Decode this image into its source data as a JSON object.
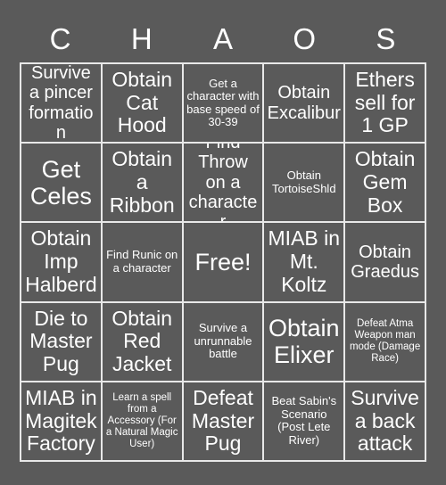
{
  "board": {
    "title_letters": [
      "C",
      "H",
      "A",
      "O",
      "S"
    ],
    "colors": {
      "background": "#5a5a5a",
      "cell_background": "#5a5a5a",
      "grid_line": "#e8e8e8",
      "text": "#ffffff"
    },
    "columns": 5,
    "rows": 5,
    "cells": [
      {
        "text": "Survive a pincer formation",
        "size": "md"
      },
      {
        "text": "Obtain Cat Hood",
        "size": "lg"
      },
      {
        "text": "Get a character with base speed of 30-39",
        "size": "sm"
      },
      {
        "text": "Obtain Excalibur",
        "size": "md"
      },
      {
        "text": "Ethers sell for 1 GP",
        "size": "lg"
      },
      {
        "text": "Get Celes",
        "size": "xl"
      },
      {
        "text": "Obtain a Ribbon",
        "size": "lg"
      },
      {
        "text": "Find Throw on a character",
        "size": "md"
      },
      {
        "text": "Obtain TortoiseShld",
        "size": "sm"
      },
      {
        "text": "Obtain Gem Box",
        "size": "lg"
      },
      {
        "text": "Obtain Imp Halberd",
        "size": "lg"
      },
      {
        "text": "Find Runic on a character",
        "size": "sm"
      },
      {
        "text": "Free!",
        "size": "xl"
      },
      {
        "text": "MIAB in Mt. Koltz",
        "size": "lg"
      },
      {
        "text": "Obtain Graedus",
        "size": "md"
      },
      {
        "text": "Die to Master Pug",
        "size": "lg"
      },
      {
        "text": "Obtain Red Jacket",
        "size": "lg"
      },
      {
        "text": "Survive a unrunnable battle",
        "size": "sm"
      },
      {
        "text": "Obtain Elixer",
        "size": "xl"
      },
      {
        "text": "Defeat Atma Weapon man mode (Damage Race)",
        "size": "xs"
      },
      {
        "text": "MIAB in Magitek Factory",
        "size": "lg"
      },
      {
        "text": "Learn a spell from a Accessory (For a Natural Magic User)",
        "size": "xs"
      },
      {
        "text": "Defeat Master Pug",
        "size": "lg"
      },
      {
        "text": "Beat Sabin's Scenario (Post Lete River)",
        "size": "sm"
      },
      {
        "text": "Survive a back attack",
        "size": "lg"
      }
    ]
  }
}
